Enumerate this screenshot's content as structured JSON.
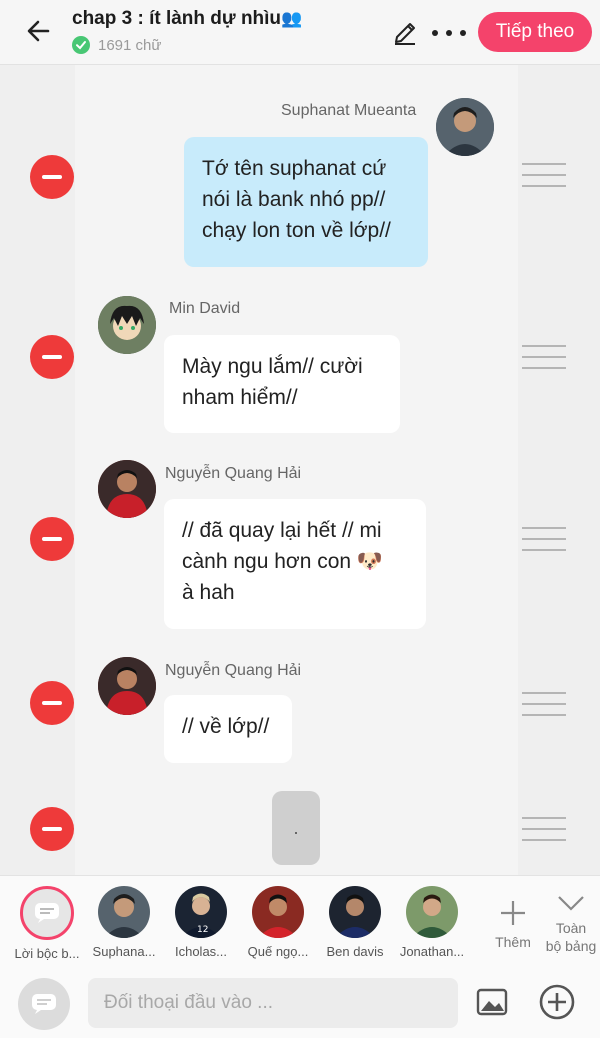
{
  "header": {
    "title": "chap 3 : ít lành dự nhìu",
    "title_emoji": "👥",
    "word_count": "1691 chữ",
    "next_button": "Tiếp theo"
  },
  "messages": [
    {
      "sender": "Suphanat Mueanta",
      "side": "right",
      "text_lines": [
        "Tớ tên suphanat cứ",
        "nói là bank nhó pp//",
        "chạy lon ton về lớp//"
      ]
    },
    {
      "sender": "Min David",
      "side": "left",
      "text_lines": [
        "Mày ngu lắm// cười",
        "nham hiểm//"
      ]
    },
    {
      "sender": "Nguyễn Quang Hải",
      "side": "left",
      "text_lines": [
        "// đã quay lại hết // mi",
        "cành ngu hơn con 🐶",
        "à hah"
      ]
    },
    {
      "sender": "Nguyễn Quang Hải",
      "side": "left",
      "text_lines": [
        "// về lớp//"
      ]
    }
  ],
  "typing_indicator": ".",
  "characters": [
    {
      "label": "Lời bộc b...",
      "icon": "narrator-icon"
    },
    {
      "label": "Suphana..."
    },
    {
      "label": "Icholas..."
    },
    {
      "label": "Quế ngọ..."
    },
    {
      "label": "Ben davis"
    },
    {
      "label": "Jonathan..."
    }
  ],
  "add_character_label": "Thêm",
  "all_label_line1": "Toàn",
  "all_label_line2": "bộ bảng",
  "input": {
    "placeholder": "Đối thoại đầu vào ..."
  },
  "colors": {
    "accent": "#f4436b",
    "delete": "#ee3a3a",
    "bubble_right": "#c8ebfb",
    "check": "#48c774"
  }
}
